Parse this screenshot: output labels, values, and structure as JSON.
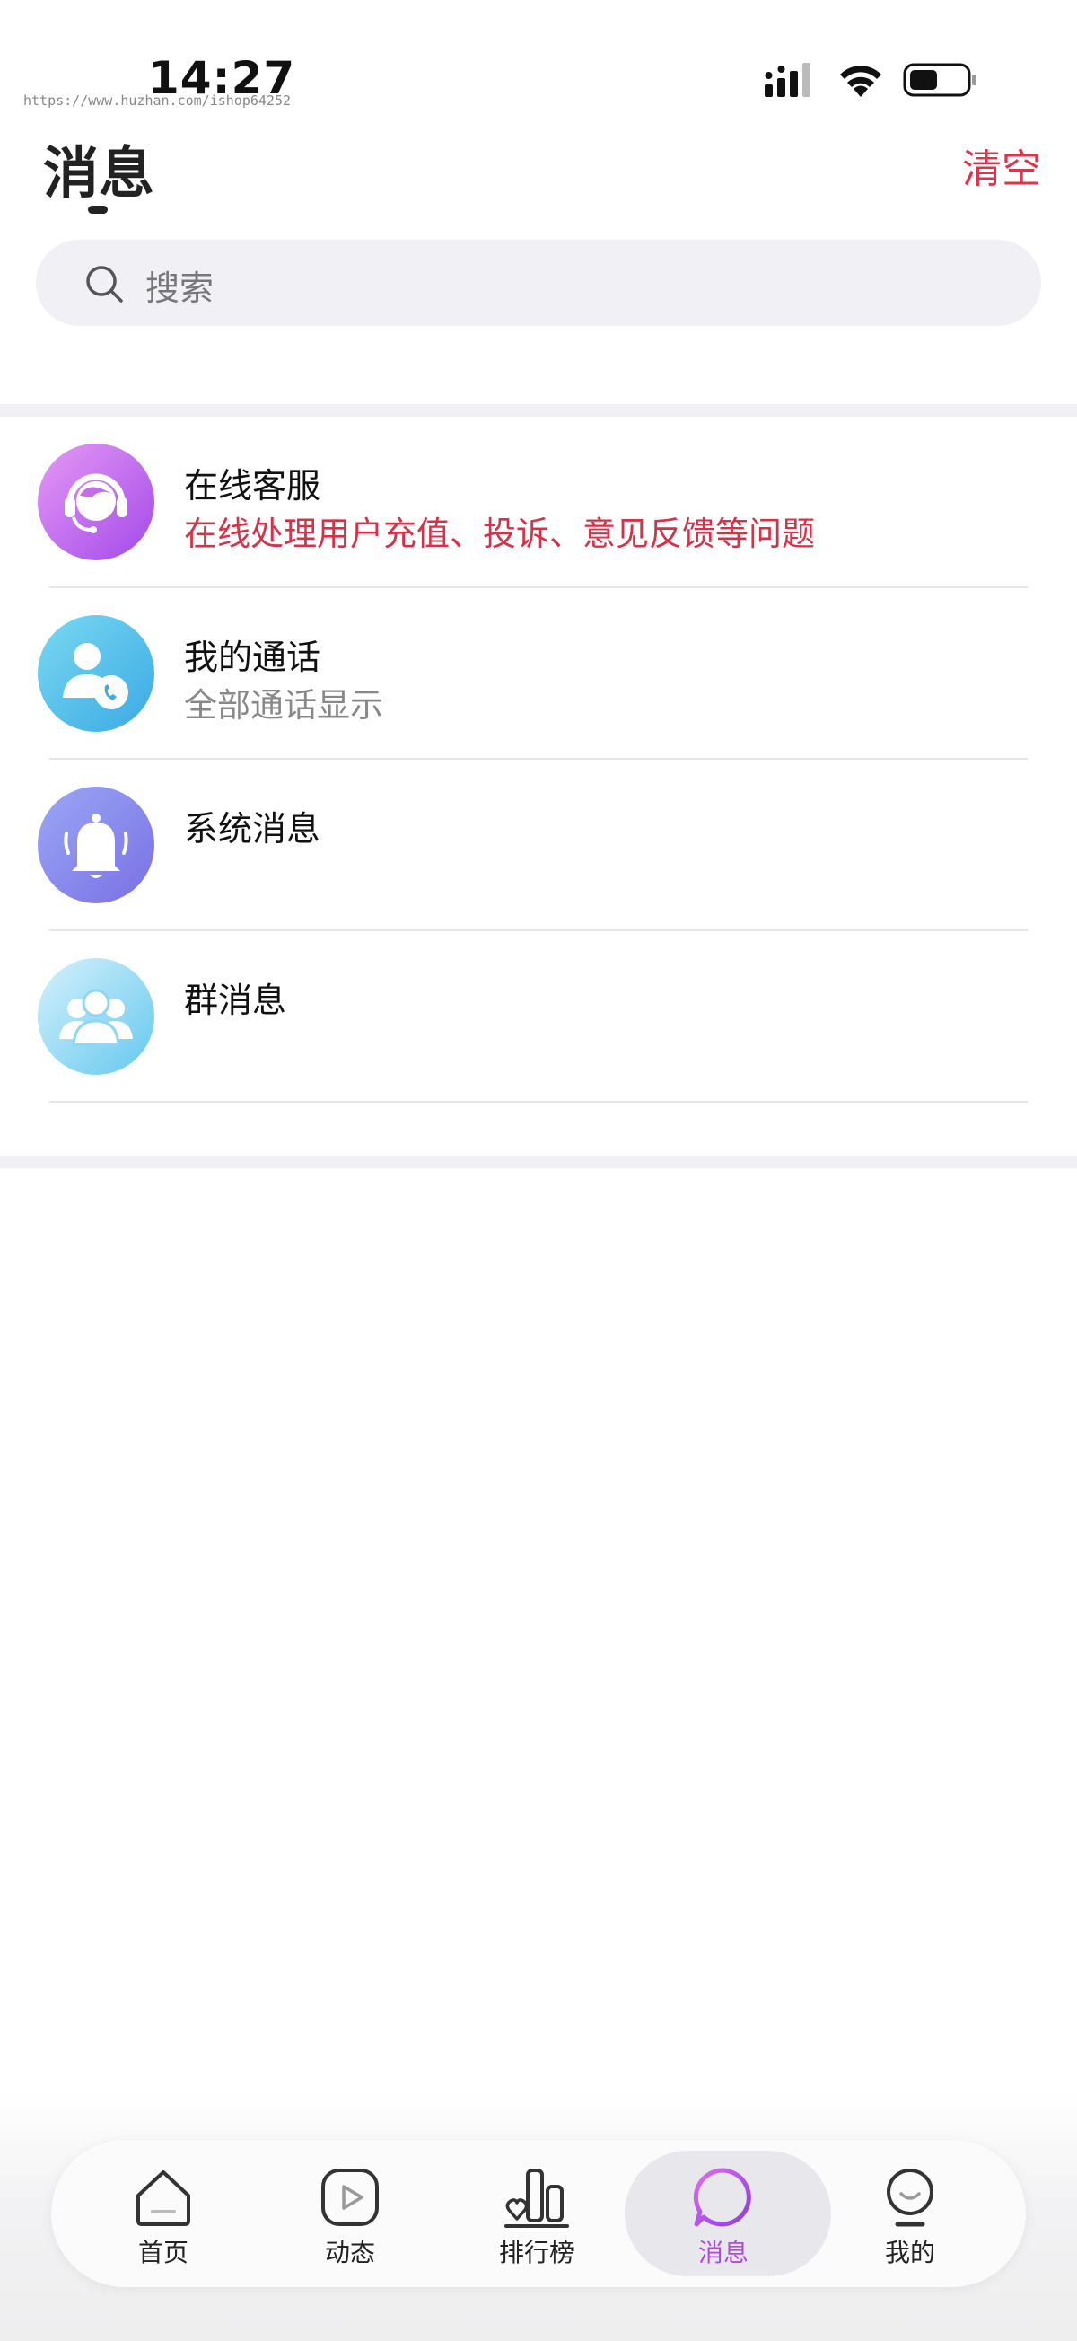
{
  "status_bar": {
    "time": "14:27",
    "watermark": "https://www.huzhan.com/ishop64252"
  },
  "header": {
    "title": "消息",
    "clear_label": "清空"
  },
  "search": {
    "placeholder": "搜索"
  },
  "items": [
    {
      "title": "在线客服",
      "subtitle": "在线处理用户充值、投诉、意见反馈等问题",
      "subtitle_color": "#d83047",
      "icon": "headset-icon"
    },
    {
      "title": "我的通话",
      "subtitle": "全部通话显示",
      "icon": "phone-contact-icon"
    },
    {
      "title": "系统消息",
      "subtitle": "",
      "icon": "bell-icon"
    },
    {
      "title": "群消息",
      "subtitle": "",
      "icon": "group-icon"
    }
  ],
  "tabs": [
    {
      "label": "首页",
      "icon": "home-icon"
    },
    {
      "label": "动态",
      "icon": "play-icon"
    },
    {
      "label": "排行榜",
      "icon": "ranking-icon"
    },
    {
      "label": "消息",
      "icon": "message-icon",
      "active": true
    },
    {
      "label": "我的",
      "icon": "profile-icon"
    }
  ],
  "colors": {
    "accent_red": "#e0334a",
    "active_tab": "#b04ae6",
    "background_band": "#f1f1f5"
  }
}
